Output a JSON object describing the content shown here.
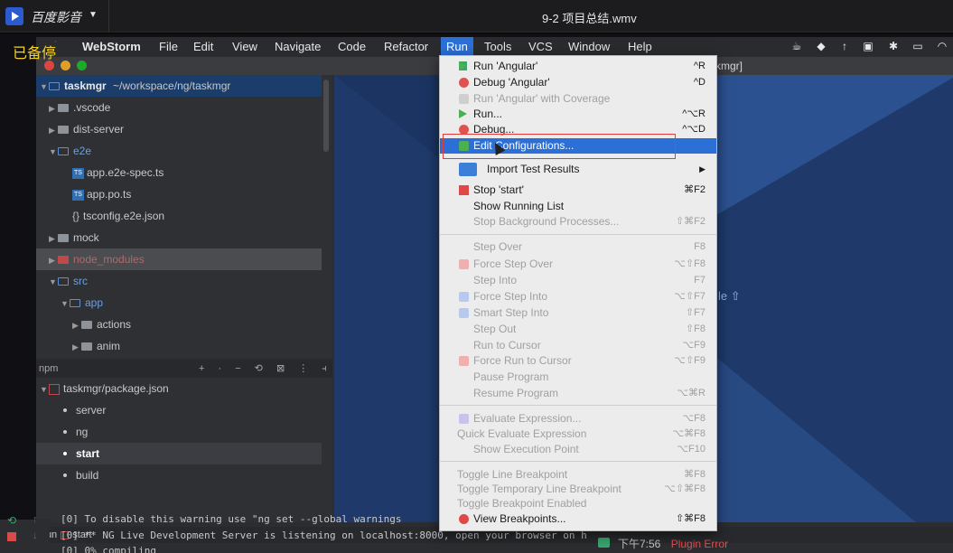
{
  "player": {
    "name": "百度影音",
    "video_title": "9-2 项目总结.wmv",
    "watermark": "已备停"
  },
  "mac_menubar": {
    "items": [
      "WebStorm",
      "File",
      "Edit",
      "View",
      "Navigate",
      "Code",
      "Refactor",
      "Run",
      "Tools",
      "VCS",
      "Window",
      "Help"
    ],
    "active": "Run"
  },
  "ide": {
    "title_right": "kmgr]",
    "project_tree": [
      {
        "label": "taskmgr",
        "suffix": "~/workspace/ng/taskmgr"
      },
      {
        "label": ".vscode"
      },
      {
        "label": "dist-server"
      },
      {
        "label": "e2e"
      },
      {
        "label": "app.e2e-spec.ts"
      },
      {
        "label": "app.po.ts"
      },
      {
        "label": "tsconfig.e2e.json"
      },
      {
        "label": "mock"
      },
      {
        "label": "node_modules"
      },
      {
        "label": "src"
      },
      {
        "label": "app"
      },
      {
        "label": "actions"
      },
      {
        "label": "anim"
      }
    ],
    "npm": {
      "header": "npm",
      "tools": "+ · − ⟲ ⊠ ⋮ ⫞",
      "package": "taskmgr/package.json",
      "scripts": [
        "server",
        "ng",
        "start",
        "build"
      ],
      "selected": "start"
    },
    "editor_hint": "le ⇧",
    "run_bar": {
      "label": "Run",
      "config": "start"
    },
    "console": [
      "[0] To disable this warning use \"ng set --global warnings",
      "[0] ** NG Live Development Server is listening on localhost:8000, open your browser on h",
      "[0]   0% compiling"
    ],
    "status": {
      "time": "下午7:56",
      "error": "Plugin Error"
    }
  },
  "run_menu": [
    {
      "label": "Run 'Angular'",
      "shortcut": "^R",
      "icon": "run-icon",
      "state": "enabled"
    },
    {
      "label": "Debug 'Angular'",
      "shortcut": "^D",
      "icon": "debug-icon",
      "state": "enabled"
    },
    {
      "label": "Run 'Angular' with Coverage",
      "shortcut": "",
      "icon": "coverage-icon",
      "state": "disabled"
    },
    {
      "label": "Run...",
      "shortcut": "^⌥R",
      "icon": "run-icon",
      "state": "enabled"
    },
    {
      "label": "Debug...",
      "shortcut": "^⌥D",
      "icon": "debug-icon",
      "state": "enabled"
    },
    {
      "label": "Edit Configurations...",
      "shortcut": "",
      "icon": "edit-config-icon",
      "state": "active"
    },
    {
      "label": "Import Test Results",
      "shortcut": "▶",
      "icon": "import-icon",
      "state": "enabled"
    },
    {
      "label": "Stop 'start'",
      "shortcut": "⌘F2",
      "icon": "stop-icon",
      "state": "enabled"
    },
    {
      "label": "Show Running List",
      "shortcut": "",
      "icon": "",
      "state": "enabled"
    },
    {
      "label": "Stop Background Processes...",
      "shortcut": "⇧⌘F2",
      "icon": "",
      "state": "disabled"
    },
    {
      "label": "Step Over",
      "shortcut": "F8",
      "icon": "",
      "state": "disabled"
    },
    {
      "label": "Force Step Over",
      "shortcut": "⌥⇧F8",
      "icon": "force-step-over-icon",
      "state": "disabled"
    },
    {
      "label": "Step Into",
      "shortcut": "F7",
      "icon": "",
      "state": "disabled"
    },
    {
      "label": "Force Step Into",
      "shortcut": "⌥⇧F7",
      "icon": "force-step-into-icon",
      "state": "disabled"
    },
    {
      "label": "Smart Step Into",
      "shortcut": "⇧F7",
      "icon": "smart-step-into-icon",
      "state": "disabled"
    },
    {
      "label": "Step Out",
      "shortcut": "⇧F8",
      "icon": "",
      "state": "disabled"
    },
    {
      "label": "Run to Cursor",
      "shortcut": "⌥F9",
      "icon": "",
      "state": "disabled"
    },
    {
      "label": "Force Run to Cursor",
      "shortcut": "⌥⇧F9",
      "icon": "force-run-icon",
      "state": "disabled"
    },
    {
      "label": "Pause Program",
      "shortcut": "",
      "icon": "",
      "state": "disabled"
    },
    {
      "label": "Resume Program",
      "shortcut": "⌥⌘R",
      "icon": "",
      "state": "disabled"
    },
    {
      "label": "Evaluate Expression...",
      "shortcut": "⌥F8",
      "icon": "evaluate-icon",
      "state": "disabled"
    },
    {
      "label": "Quick Evaluate Expression",
      "shortcut": "⌥⌘F8",
      "icon": "",
      "state": "disabled"
    },
    {
      "label": "Show Execution Point",
      "shortcut": "⌥F10",
      "icon": "",
      "state": "disabled"
    },
    {
      "label": "Toggle Line Breakpoint",
      "shortcut": "⌘F8",
      "icon": "",
      "state": "disabled"
    },
    {
      "label": "Toggle Temporary Line Breakpoint",
      "shortcut": "⌥⇧⌘F8",
      "icon": "",
      "state": "disabled"
    },
    {
      "label": "Toggle Breakpoint Enabled",
      "shortcut": "",
      "icon": "",
      "state": "disabled"
    },
    {
      "label": "View Breakpoints...",
      "shortcut": "⇧⌘F8",
      "icon": "breakpoints-icon",
      "state": "enabled"
    }
  ],
  "colors": {
    "accent": "#2c6fd6",
    "highlight_box": "#e23b3b",
    "watermark": "#f5d22a"
  }
}
